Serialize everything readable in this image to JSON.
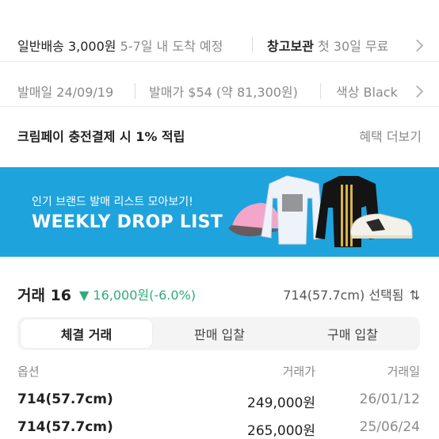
{
  "shipping": {
    "normal_label": "일반배송",
    "normal_price": "3,000원",
    "normal_eta": "5-7일 내 도착 예정",
    "storage_label": "창고보관",
    "storage_desc": "첫 30일 무료"
  },
  "release": {
    "date_label": "발매일",
    "date_value": "24/09/19",
    "price_label": "발매가",
    "price_value": "$54 (약 81,300원)",
    "color_label": "색상",
    "color_value": "Black"
  },
  "pay": {
    "text": "크림페이 충전결제 시 1% 적립",
    "link": "혜택 더보기"
  },
  "banner": {
    "subtitle": "인기 브랜드 발매 리스트 모아보기!",
    "title": "WEEKLY DROP LIST",
    "bg_color": "#1fa3dc"
  },
  "trades": {
    "label": "거래 16",
    "change_icon": "triangle-down-icon",
    "change": "16,000원(-6.0%)",
    "selected": "714(57.7cm) 선택됨"
  },
  "tabs": [
    {
      "label": "체결 거래",
      "active": true
    },
    {
      "label": "판매 입찰",
      "active": false
    },
    {
      "label": "구매 입찰",
      "active": false
    }
  ],
  "table": {
    "headers": [
      "옵션",
      "거래가",
      "거래일"
    ],
    "rows": [
      [
        "714(57.7cm)",
        "249,000원",
        "26/01/12"
      ],
      [
        "714(57.7cm)",
        "265,000원",
        "25/06/24"
      ]
    ]
  },
  "colors": {
    "accent_green": "#2fab7a",
    "banner_blue": "#1fa3dc"
  }
}
